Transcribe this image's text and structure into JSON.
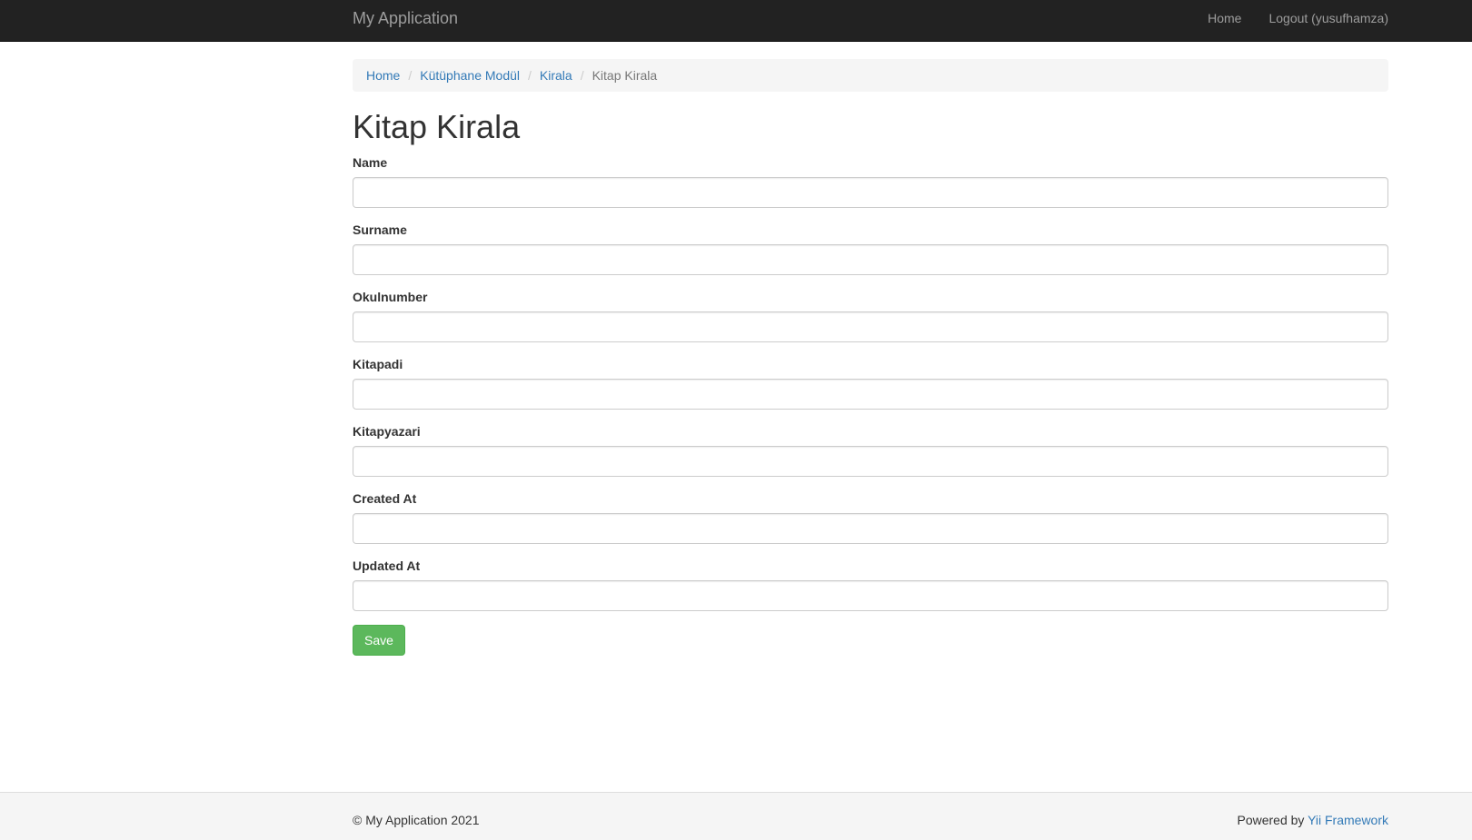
{
  "navbar": {
    "brand": "My Application",
    "links": {
      "home": "Home",
      "logout": "Logout (yusufhamza)"
    }
  },
  "breadcrumb": {
    "items": [
      "Home",
      "Kütüphane Modül",
      "Kirala"
    ],
    "active": "Kitap Kirala",
    "separator": "/"
  },
  "page": {
    "title": "Kitap Kirala"
  },
  "form": {
    "fields": {
      "name": {
        "label": "Name",
        "value": ""
      },
      "surname": {
        "label": "Surname",
        "value": ""
      },
      "okulnumber": {
        "label": "Okulnumber",
        "value": ""
      },
      "kitapadi": {
        "label": "Kitapadi",
        "value": ""
      },
      "kitapyazari": {
        "label": "Kitapyazari",
        "value": ""
      },
      "created_at": {
        "label": "Created At",
        "value": ""
      },
      "updated_at": {
        "label": "Updated At",
        "value": ""
      }
    },
    "save_label": "Save"
  },
  "footer": {
    "copyright": "© My Application 2021",
    "powered_prefix": "Powered by ",
    "powered_link": "Yii Framework"
  },
  "colors": {
    "navbar_bg": "#222222",
    "link": "#337ab7",
    "save_button": "#5cb85c"
  }
}
